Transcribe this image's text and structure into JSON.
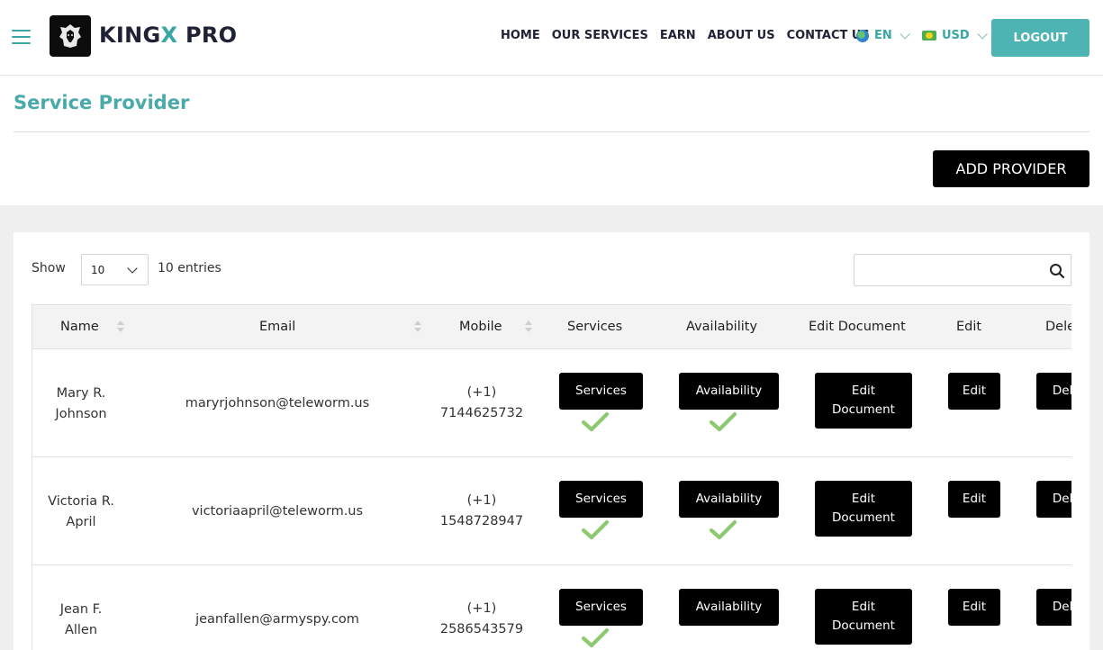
{
  "header": {
    "logo_main": "KING",
    "logo_x": "X",
    "logo_pro": " PRO",
    "nav": [
      "HOME",
      "OUR SERVICES",
      "EARN",
      "ABOUT US",
      "CONTACT US"
    ],
    "language": "EN",
    "currency": "USD",
    "logout_label": "LOGOUT"
  },
  "page": {
    "title": "Service Provider",
    "add_button": "ADD PROVIDER"
  },
  "table_controls": {
    "show_label": "Show",
    "page_size": "10",
    "entries_label": "10 entries",
    "search_value": ""
  },
  "table": {
    "columns": [
      "Name",
      "Email",
      "Mobile",
      "Services",
      "Availability",
      "Edit Document",
      "Edit",
      "Delete"
    ],
    "rows": [
      {
        "name_line1": "Mary R.",
        "name_line2": "Johnson",
        "email": "maryrjohnson@teleworm.us",
        "mobile_line1": "(+1)",
        "mobile_line2": "7144625732",
        "services_label": "Services",
        "availability_label": "Availability",
        "edit_doc_line1": "Edit",
        "edit_doc_line2": "Document",
        "edit_label": "Edit",
        "delete_label": "Delete",
        "services_checked": true,
        "availability_checked": true
      },
      {
        "name_line1": "Victoria R.",
        "name_line2": "April",
        "email": "victoriaapril@teleworm.us",
        "mobile_line1": "(+1)",
        "mobile_line2": "1548728947",
        "services_label": "Services",
        "availability_label": "Availability",
        "edit_doc_line1": "Edit",
        "edit_doc_line2": "Document",
        "edit_label": "Edit",
        "delete_label": "Delete",
        "services_checked": true,
        "availability_checked": true
      },
      {
        "name_line1": "Jean F.",
        "name_line2": "Allen",
        "email": "jeanfallen@armyspy.com",
        "mobile_line1": "(+1)",
        "mobile_line2": "2586543579",
        "services_label": "Services",
        "availability_label": "Availability",
        "edit_doc_line1": "Edit",
        "edit_doc_line2": "Document",
        "edit_label": "Edit",
        "delete_label": "Delete",
        "services_checked": true,
        "availability_checked": false
      }
    ]
  },
  "colors": {
    "accent": "#4db3b3",
    "check": "#8dc971",
    "band": "#efefef"
  }
}
